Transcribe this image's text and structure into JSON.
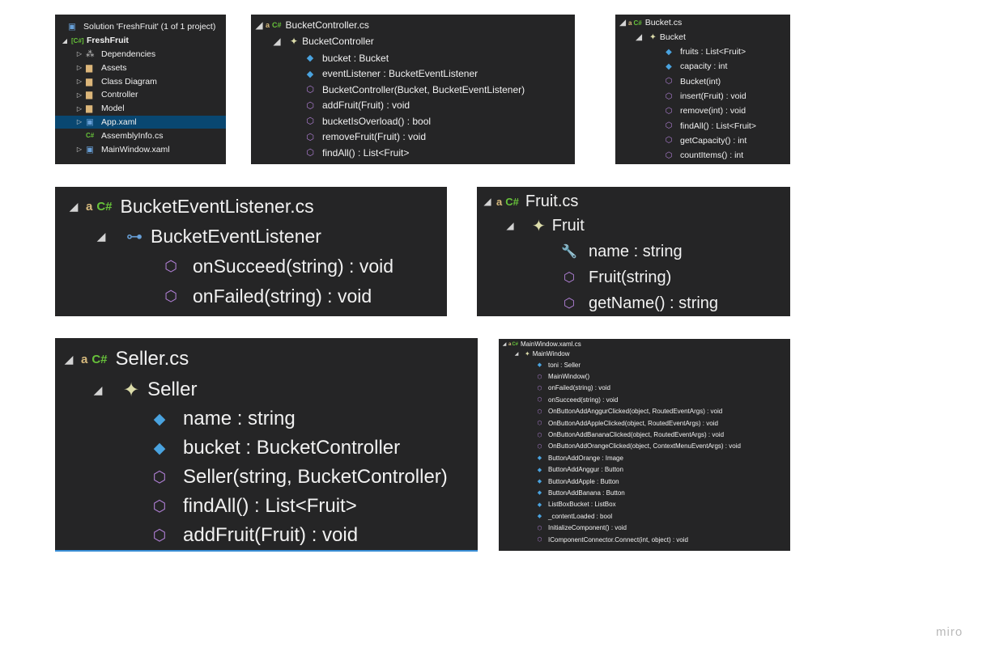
{
  "solution_explorer": {
    "items": [
      {
        "icon": "solution-icon",
        "label": "Solution 'FreshFruit' (1 of 1 project)"
      },
      {
        "icon": "project-icon",
        "label": "FreshFruit"
      },
      {
        "icon": "dependencies-icon",
        "label": "Dependencies"
      },
      {
        "icon": "folder-icon",
        "label": "Assets"
      },
      {
        "icon": "folder-icon",
        "label": "Class Diagram"
      },
      {
        "icon": "folder-icon",
        "label": "Controller"
      },
      {
        "icon": "folder-icon",
        "label": "Model"
      },
      {
        "icon": "xaml-file-icon",
        "label": "App.xaml",
        "selected": true
      },
      {
        "icon": "csharp-file-icon",
        "label": "AssemblyInfo.cs"
      },
      {
        "icon": "xaml-file-icon",
        "label": "MainWindow.xaml"
      }
    ]
  },
  "bucket_controller": {
    "file": "BucketController.cs",
    "class": "BucketController",
    "members": [
      {
        "kind": "field",
        "label": "bucket : Bucket"
      },
      {
        "kind": "field",
        "label": "eventListener : BucketEventListener"
      },
      {
        "kind": "method",
        "label": "BucketController(Bucket, BucketEventListener)"
      },
      {
        "kind": "method",
        "label": "addFruit(Fruit) : void"
      },
      {
        "kind": "method",
        "label": "bucketIsOverload() : bool"
      },
      {
        "kind": "method",
        "label": "removeFruit(Fruit) : void"
      },
      {
        "kind": "method",
        "label": "findAll() : List<Fruit>"
      }
    ]
  },
  "bucket": {
    "file": "Bucket.cs",
    "class": "Bucket",
    "members": [
      {
        "kind": "field",
        "label": "fruits : List<Fruit>"
      },
      {
        "kind": "field",
        "label": "capacity : int"
      },
      {
        "kind": "method",
        "label": "Bucket(int)"
      },
      {
        "kind": "method",
        "label": "insert(Fruit) : void"
      },
      {
        "kind": "method",
        "label": "remove(int) : void"
      },
      {
        "kind": "method",
        "label": "findAll() : List<Fruit>"
      },
      {
        "kind": "method",
        "label": "getCapacity() : int"
      },
      {
        "kind": "method",
        "label": "countItems() : int"
      }
    ]
  },
  "bucket_event_listener": {
    "file": "BucketEventListener.cs",
    "class": "BucketEventListener",
    "members": [
      {
        "kind": "method",
        "label": "onSucceed(string) : void"
      },
      {
        "kind": "method",
        "label": "onFailed(string) : void"
      }
    ]
  },
  "fruit": {
    "file": "Fruit.cs",
    "class": "Fruit",
    "members": [
      {
        "kind": "property",
        "label": "name : string"
      },
      {
        "kind": "method",
        "label": "Fruit(string)"
      },
      {
        "kind": "method",
        "label": "getName() : string"
      }
    ]
  },
  "seller": {
    "file": "Seller.cs",
    "class": "Seller",
    "members": [
      {
        "kind": "field",
        "label": "name : string"
      },
      {
        "kind": "field",
        "label": "bucket : BucketController"
      },
      {
        "kind": "method",
        "label": "Seller(string, BucketController)"
      },
      {
        "kind": "method",
        "label": "findAll() : List<Fruit>"
      },
      {
        "kind": "method",
        "label": "addFruit(Fruit) : void"
      }
    ]
  },
  "main_window": {
    "file": "MainWindow.xaml.cs",
    "class": "MainWindow",
    "members": [
      {
        "kind": "field",
        "label": "toni : Seller"
      },
      {
        "kind": "method",
        "label": "MainWindow()"
      },
      {
        "kind": "method",
        "label": "onFailed(string) : void"
      },
      {
        "kind": "method",
        "label": "onSucceed(string) : void"
      },
      {
        "kind": "method",
        "label": "OnButtonAddAnggurClicked(object, RoutedEventArgs) : void"
      },
      {
        "kind": "method",
        "label": "OnButtonAddAppleClicked(object, RoutedEventArgs) : void"
      },
      {
        "kind": "method",
        "label": "OnButtonAddBananaClicked(object, RoutedEventArgs) : void"
      },
      {
        "kind": "method",
        "label": "OnButtonAddOrangeClicked(object, ContextMenuEventArgs) : void"
      },
      {
        "kind": "field",
        "label": "ButtonAddOrange : Image"
      },
      {
        "kind": "field",
        "label": "ButtonAddAnggur : Button"
      },
      {
        "kind": "field",
        "label": "ButtonAddApple : Button"
      },
      {
        "kind": "field",
        "label": "ButtonAddBanana : Button"
      },
      {
        "kind": "field",
        "label": "ListBoxBucket : ListBox"
      },
      {
        "kind": "field",
        "label": "_contentLoaded : bool"
      },
      {
        "kind": "method",
        "label": "InitializeComponent() : void"
      },
      {
        "kind": "method",
        "label": "IComponentConnector.Connect(int, object) : void"
      }
    ]
  },
  "watermark": "miro"
}
